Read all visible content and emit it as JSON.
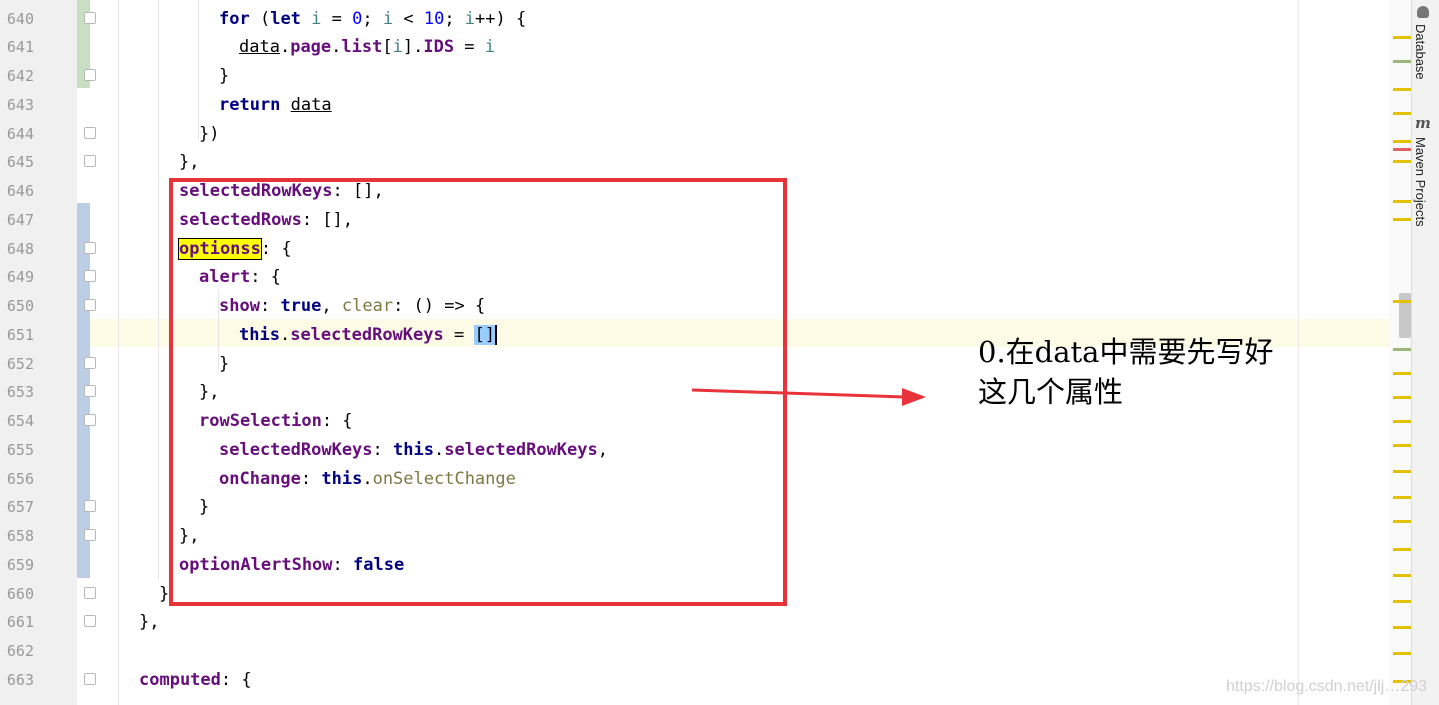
{
  "editor": {
    "line_numbers": [
      "640",
      "641",
      "642",
      "643",
      "644",
      "645",
      "646",
      "647",
      "648",
      "649",
      "650",
      "651",
      "652",
      "653",
      "654",
      "655",
      "656",
      "657",
      "658",
      "659",
      "660",
      "661",
      "662",
      "663"
    ],
    "current_line": "651"
  },
  "code": {
    "l640": {
      "kw_for": "for",
      "p1": " (",
      "kw_let": "let",
      "v_i": " i",
      "eq": " = ",
      "n0": "0",
      "semi1": "; ",
      "v_i2": "i",
      "lt": " < ",
      "n10": "10",
      "semi2": "; ",
      "v_i3": "i",
      "rest": "++) {"
    },
    "l641": {
      "data": "data",
      "dot1": ".",
      "page": "page",
      "dot2": ".",
      "list": "list",
      "br1": "[",
      "i": "i",
      "br2": "].",
      "ids": "IDS",
      "eq": " = ",
      "i2": "i"
    },
    "l642": {
      "text": "}"
    },
    "l643": {
      "kw_return": "return",
      "data": "data"
    },
    "l644": {
      "text": "})"
    },
    "l645": {
      "text": "},"
    },
    "l646": {
      "key": "selectedRowKeys",
      "rest": ": [],"
    },
    "l647": {
      "key": "selectedRows",
      "rest": ": [],"
    },
    "l648": {
      "key": "optionss",
      "rest": ": {"
    },
    "l649": {
      "key": "alert",
      "rest": ": {"
    },
    "l650": {
      "key": "show",
      "c1": ": ",
      "kw_true": "true",
      "c2": ", ",
      "clear": "clear",
      "rest": ": () => {"
    },
    "l651": {
      "kw_this": "this",
      "dot": ".",
      "prop": "selectedRowKeys",
      "eq": " = ",
      "brk": "[]"
    },
    "l652": {
      "text": "}"
    },
    "l653": {
      "text": "},"
    },
    "l654": {
      "key": "rowSelection",
      "rest": ": {"
    },
    "l655": {
      "key": "selectedRowKeys",
      "c1": ": ",
      "kw_this": "this",
      "dot": ".",
      "prop": "selectedRowKeys",
      "rest": ","
    },
    "l656": {
      "key": "onChange",
      "c1": ": ",
      "kw_this": "this",
      "dot": ".",
      "fn": "onSelectChange"
    },
    "l657": {
      "text": "}"
    },
    "l658": {
      "text": "},"
    },
    "l659": {
      "key": "optionAlertShow",
      "c1": ": ",
      "kw_false": "false"
    },
    "l660": {
      "text": "}"
    },
    "l661": {
      "text": "},"
    },
    "l663": {
      "key": "computed",
      "rest": ": {"
    }
  },
  "annotation": {
    "line1": "0.在data中需要先写好",
    "line2": "这几个属性"
  },
  "tool_windows": {
    "database": "Database",
    "maven": "Maven Projects"
  },
  "watermark": "https://blog.csdn.net/jlj…293",
  "colors": {
    "annotation_box": "#e8333a",
    "search_highlight": "#ffff00",
    "keyword": "#000080",
    "property": "#660e7a"
  }
}
